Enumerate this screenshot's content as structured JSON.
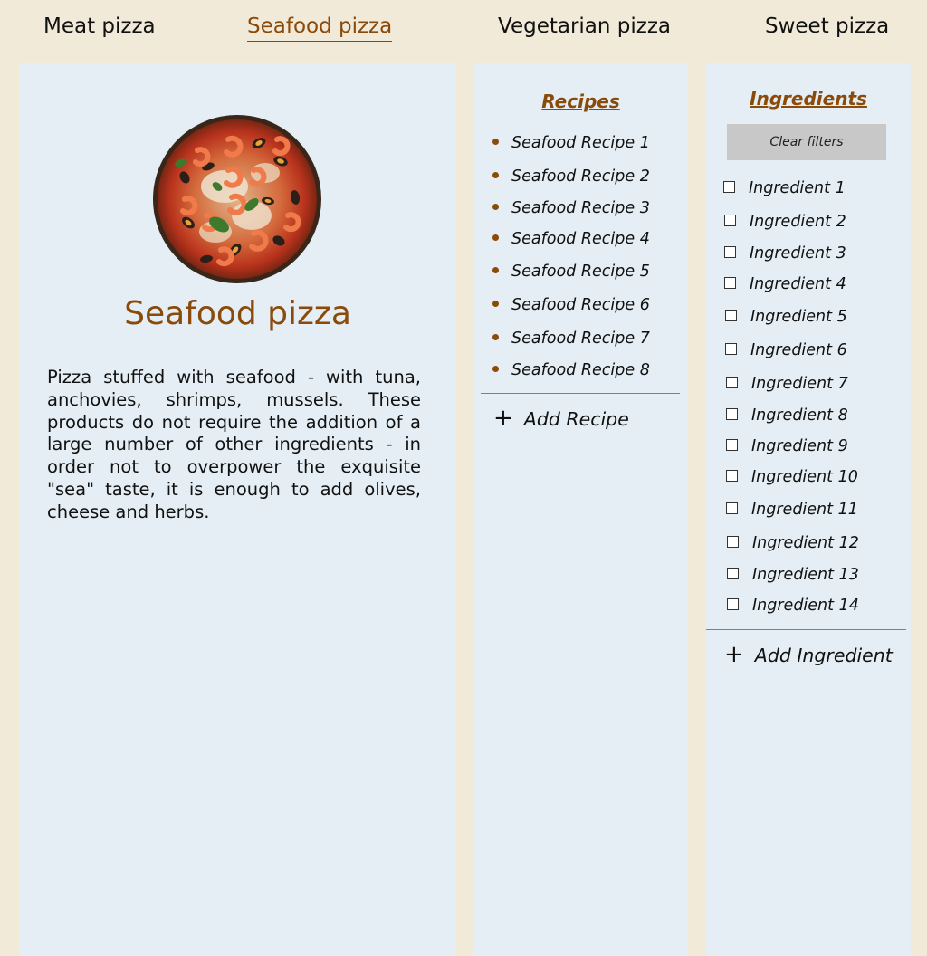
{
  "nav": {
    "tabs": [
      {
        "label": "Meat pizza"
      },
      {
        "label": "Seafood pizza"
      },
      {
        "label": "Vegetarian pizza"
      },
      {
        "label": "Sweet pizza"
      }
    ]
  },
  "main": {
    "title": "Seafood pizza",
    "description": "Pizza stuffed with seafood - with tuna, anchovies, shrimps, mussels. These products do not require the addition of a large number of other ingredients - in order not to overpower the exquisite \"sea\" taste, it is enough to add olives, cheese and herbs."
  },
  "recipes": {
    "heading": "Recipes",
    "items": [
      {
        "label": "Seafood Recipe 1"
      },
      {
        "label": "Seafood Recipe 2"
      },
      {
        "label": "Seafood Recipe 3"
      },
      {
        "label": "Seafood Recipe 4"
      },
      {
        "label": "Seafood Recipe 5"
      },
      {
        "label": "Seafood Recipe 6"
      },
      {
        "label": "Seafood Recipe 7"
      },
      {
        "label": "Seafood Recipe 8"
      }
    ],
    "add_label": "Add Recipe"
  },
  "ingredients": {
    "heading": "Ingredients",
    "clear_label": "Clear filters",
    "items": [
      {
        "label": "Ingredient 1"
      },
      {
        "label": "Ingredient 2"
      },
      {
        "label": "Ingredient 3"
      },
      {
        "label": "Ingredient 4"
      },
      {
        "label": "Ingredient 5"
      },
      {
        "label": "Ingredient 6"
      },
      {
        "label": "Ingredient 7"
      },
      {
        "label": "Ingredient 8"
      },
      {
        "label": "Ingredient 9"
      },
      {
        "label": "Ingredient 10"
      },
      {
        "label": "Ingredient 11"
      },
      {
        "label": "Ingredient 12"
      },
      {
        "label": "Ingredient 13"
      },
      {
        "label": "Ingredient 14"
      }
    ],
    "add_label": "Add Ingredient"
  },
  "colors": {
    "page_bg": "#f1ead9",
    "panel_bg": "#e4eef4",
    "accent": "#8a4a0a"
  }
}
